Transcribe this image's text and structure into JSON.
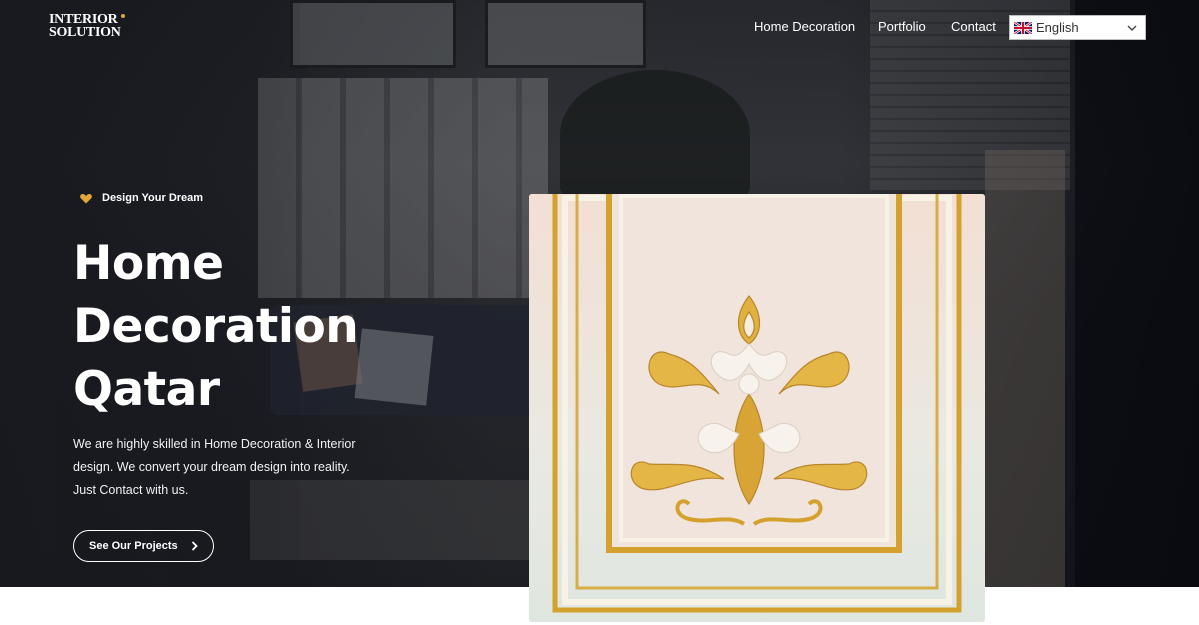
{
  "brand": {
    "line1": "INTERIOR",
    "line2": "SOLUTION"
  },
  "nav": {
    "items": [
      {
        "label": "Home Decoration"
      },
      {
        "label": "Portfolio"
      },
      {
        "label": "Contact"
      }
    ]
  },
  "language": {
    "selected": "English",
    "icon": "uk-flag-icon"
  },
  "hero": {
    "tagline": "Design Your Dream",
    "tagline_icon": "heart-icon",
    "title_lines": [
      "Home",
      "Decoration",
      "Qatar"
    ],
    "description_lines": [
      "We are highly skilled in Home Decoration & Interior",
      "design. We convert your dream design into reality.",
      "Just Contact with us."
    ],
    "cta_label": "See Our Projects",
    "cta_icon": "chevron-right-icon"
  },
  "colors": {
    "accent": "#e3a63a",
    "gold": "#d4a12f",
    "panel_bg": "#efe6dd"
  }
}
